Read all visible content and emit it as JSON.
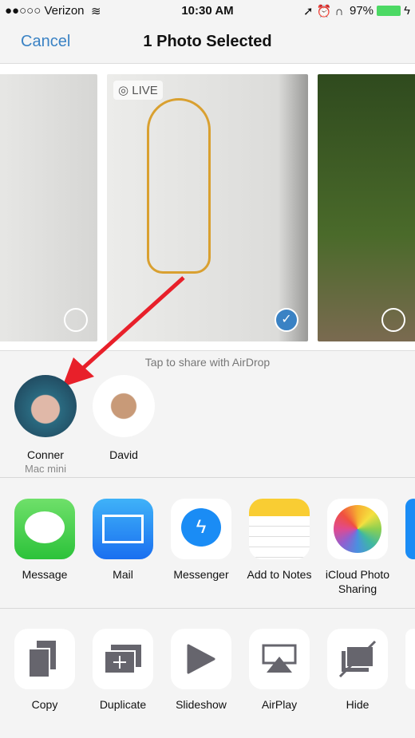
{
  "status": {
    "carrier": "●●○○○ Verizon",
    "time": "10:30 AM",
    "battery": "97%"
  },
  "nav": {
    "cancel": "Cancel",
    "title": "1 Photo Selected"
  },
  "photos": {
    "live_badge": "LIVE"
  },
  "airdrop": {
    "label": "Tap to share with AirDrop",
    "people": [
      {
        "name": "Conner",
        "device": "Mac mini"
      },
      {
        "name": "David"
      }
    ]
  },
  "apps": [
    {
      "label": "Message"
    },
    {
      "label": "Mail"
    },
    {
      "label": "Messenger"
    },
    {
      "label": "Add to Notes"
    },
    {
      "label": "iCloud Photo Sharing"
    }
  ],
  "actions": [
    {
      "label": "Copy"
    },
    {
      "label": "Duplicate"
    },
    {
      "label": "Slideshow"
    },
    {
      "label": "AirPlay"
    },
    {
      "label": "Hide"
    }
  ],
  "colors": {
    "accent": "#3a82c4",
    "battery": "#4cd964",
    "arrow": "#e8202a",
    "icon_gray": "#66656d"
  }
}
